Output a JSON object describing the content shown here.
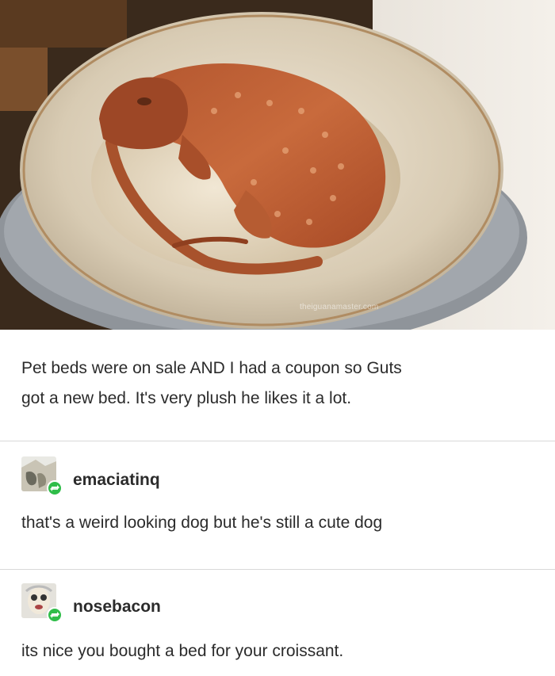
{
  "photo": {
    "watermark": "theiguanamaster.com",
    "subject": "red tegu lizard curled in a plush round pet bed"
  },
  "caption": "Pet beds were on sale AND I had a coupon so Guts\ngot a new bed.  It's very plush he likes it a lot.",
  "replies": [
    {
      "username": "emaciatinq",
      "text": "that's a weird looking dog but he's still a cute dog",
      "avatar_icon": "user-avatar-icon",
      "badge_icon": "reblog-icon"
    },
    {
      "username": "nosebacon",
      "text": "its nice you bought a bed for your croissant.",
      "avatar_icon": "user-avatar-icon",
      "badge_icon": "reblog-icon"
    }
  ],
  "colors": {
    "text": "#2b2b2b",
    "divider": "#d9d9d9",
    "reblog_badge": "#2fbd49"
  }
}
